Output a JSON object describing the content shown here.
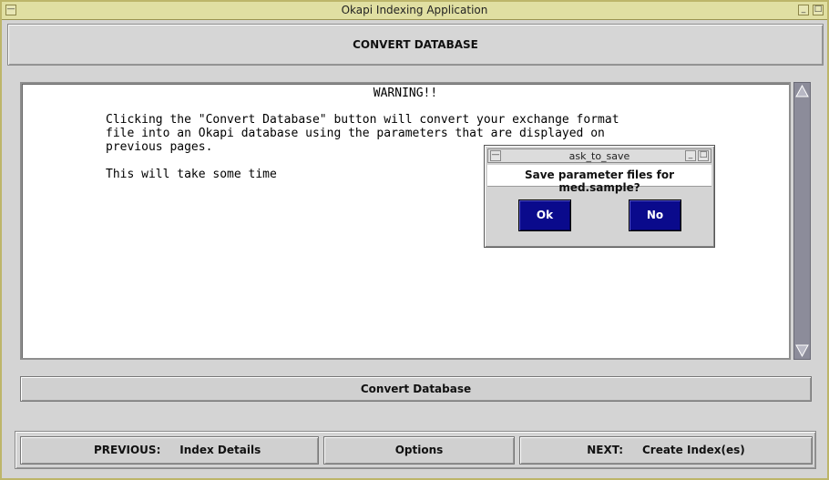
{
  "window": {
    "title": "Okapi Indexing Application",
    "minimize_glyph": "_",
    "maximize_glyph": "□",
    "menu_glyph": "—"
  },
  "header": {
    "title": "CONVERT DATABASE"
  },
  "message": {
    "heading": "WARNING!!",
    "body": "Clicking the \"Convert Database\" button will convert your exchange format\nfile into an Okapi database using the parameters that are displayed on\nprevious pages.",
    "note": "This will take some time"
  },
  "actions": {
    "convert_label": "Convert Database"
  },
  "nav": {
    "previous_label": "PREVIOUS:     Index Details",
    "options_label": "Options",
    "next_label": "NEXT:     Create Index(es)"
  },
  "dialog": {
    "title": "ask_to_save",
    "message": "Save parameter files for med.sample?",
    "ok_label": "Ok",
    "no_label": "No",
    "minimize_glyph": "_",
    "maximize_glyph": "□",
    "menu_glyph": "—"
  },
  "colors": {
    "titlebar": "#e0dfa2",
    "dialog_button": "#0a0a8c",
    "scrollbar": "#8c8c9a"
  },
  "icons": {
    "scroll_up": "scroll-up-arrow-icon",
    "scroll_down": "scroll-down-arrow-icon"
  }
}
